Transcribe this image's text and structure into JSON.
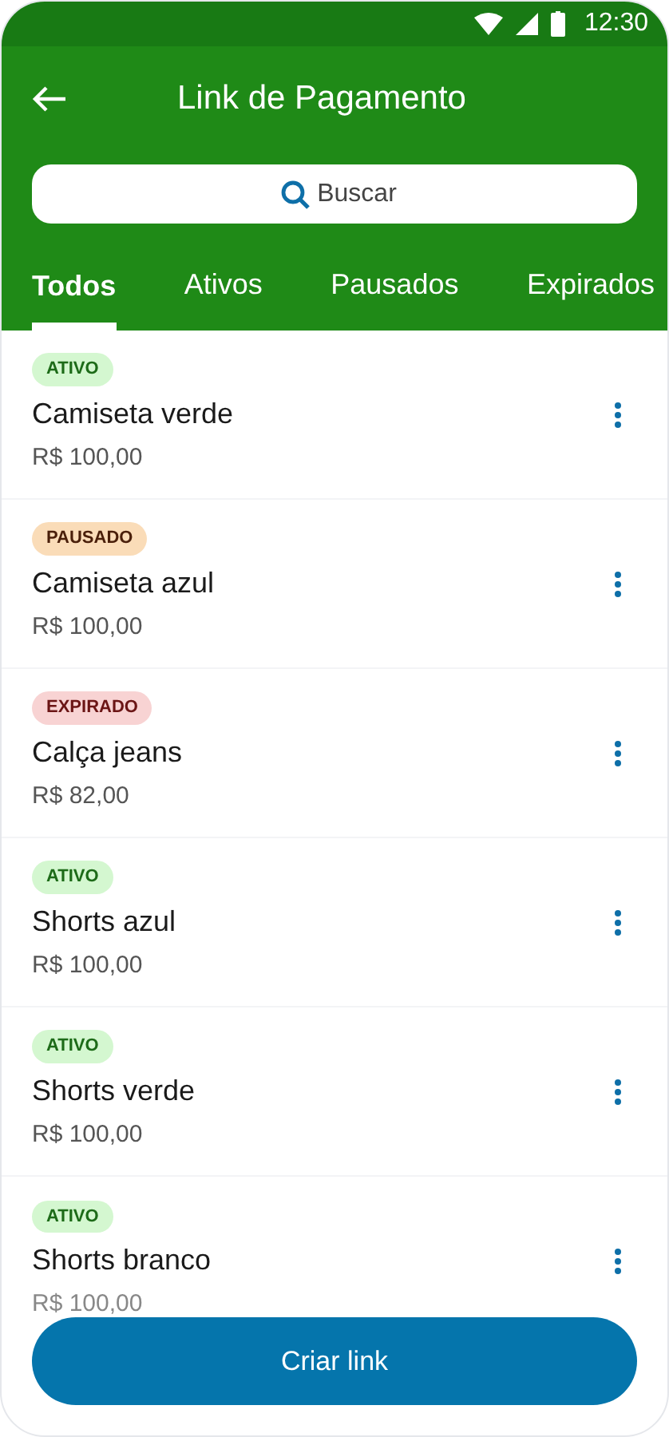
{
  "status_bar": {
    "time": "12:30"
  },
  "header": {
    "title": "Link de Pagamento"
  },
  "search": {
    "placeholder": "Buscar"
  },
  "tabs": [
    {
      "label": "Todos",
      "selected": true
    },
    {
      "label": "Ativos",
      "selected": false
    },
    {
      "label": "Pausados",
      "selected": false
    },
    {
      "label": "Expirados",
      "selected": false
    }
  ],
  "links": [
    {
      "status": "ATIVO",
      "kind": "active",
      "name": "Camiseta verde",
      "price": "R$ 100,00"
    },
    {
      "status": "PAUSADO",
      "kind": "paused",
      "name": "Camiseta azul",
      "price": "R$ 100,00"
    },
    {
      "status": "EXPIRADO",
      "kind": "expired",
      "name": "Calça jeans",
      "price": "R$ 82,00"
    },
    {
      "status": "ATIVO",
      "kind": "active",
      "name": "Shorts azul",
      "price": "R$ 100,00"
    },
    {
      "status": "ATIVO",
      "kind": "active",
      "name": "Shorts verde",
      "price": "R$ 100,00"
    },
    {
      "status": "ATIVO",
      "kind": "active",
      "name": "Shorts branco",
      "price": "R$ 100,00"
    }
  ],
  "primary_button": "Criar link"
}
